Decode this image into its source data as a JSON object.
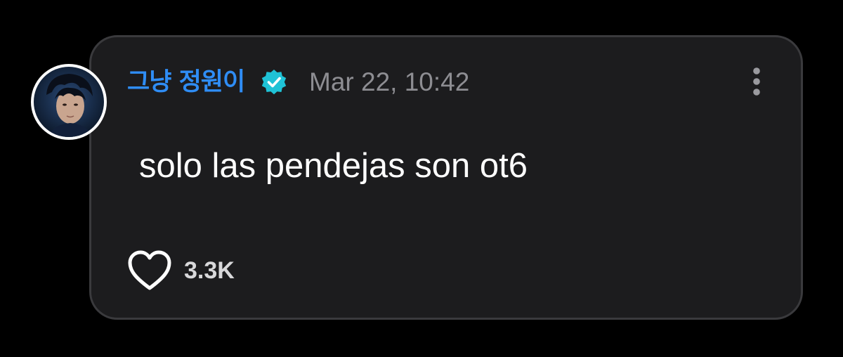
{
  "post": {
    "username": "그냥 정원이",
    "verified": true,
    "timestamp": "Mar 22, 10:42",
    "text": "solo las pendejas son ot6",
    "likes": "3.3K"
  },
  "icons": {
    "verified": "verified-badge-icon",
    "more": "more-vertical-icon",
    "like": "heart-outline-icon"
  },
  "colors": {
    "background": "#000000",
    "card": "#1c1c1e",
    "username": "#2f8df5",
    "verified_badge": "#1fc2d6",
    "timestamp": "#8d8d92",
    "text": "#ffffff"
  }
}
